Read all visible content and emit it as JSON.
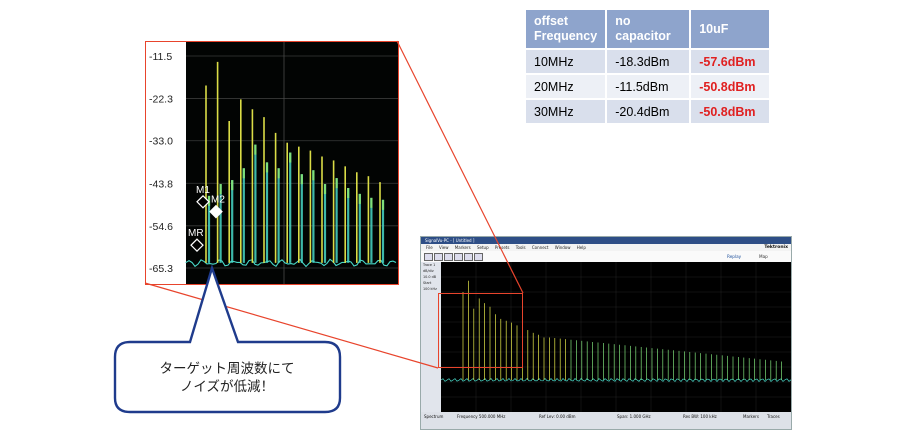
{
  "table": {
    "headers": [
      "offset\nFrequency",
      "no\ncapacitor",
      "10uF"
    ],
    "header_lines": [
      [
        "offset",
        "Frequency"
      ],
      [
        "no",
        "capacitor"
      ],
      [
        "10uF"
      ]
    ],
    "rows": [
      {
        "freq": "10MHz",
        "no_cap": "-18.3dBm",
        "cap_10uF": "-57.6dBm"
      },
      {
        "freq": "20MHz",
        "no_cap": "-11.5dBm",
        "cap_10uF": "-50.8dBm"
      },
      {
        "freq": "30MHz",
        "no_cap": "-20.4dBm",
        "cap_10uF": "-50.8dBm"
      }
    ],
    "highlight_color": "#e02020",
    "header_bg": "#8ea4cc"
  },
  "callout": {
    "line1": "ターゲット周波数にて",
    "line2": "ノイズが低減！",
    "border_color": "#1f3b8c"
  },
  "colors": {
    "zoom_border": "#e8442c",
    "trace_yellow": "#e6e84a",
    "trace_cyan": "#48d8c8",
    "trace_green": "#7fe07a"
  },
  "chart_data": {
    "type": "line",
    "title": "",
    "xlabel": "",
    "ylabel": "",
    "y_ticks": [
      -11.5,
      -22.3,
      -33.0,
      -43.8,
      -54.6,
      -65.3
    ],
    "y_tick_labels": [
      "-11.5",
      "-22.3",
      "-33.0",
      "-43.8",
      "-54.6",
      "-65.3"
    ],
    "ylim": [
      -65.3,
      -11.5
    ],
    "grid": true,
    "series": [
      {
        "color": "#e6e84a",
        "peaks": [
          -19.0,
          -13.0,
          -28.0,
          -22.5,
          -25.0,
          -27.0,
          -31.0,
          -33.5,
          -34.5,
          -35.5,
          -37.0,
          -38.0,
          -39.5,
          -41.0,
          -42.0,
          -43.5
        ]
      },
      {
        "color": "#48d8c8",
        "peaks": [
          -47.0,
          -44.0,
          -43.0,
          -40.0,
          -34.0,
          -38.5,
          -40.0,
          -36.0,
          -41.5,
          -40.5,
          -44.0,
          -42.5,
          -45.0,
          -46.5,
          -47.5,
          -48.0
        ]
      }
    ],
    "noise_floor": -64.0,
    "markers": [
      {
        "label": "M1",
        "y": -48.5
      },
      {
        "label": "M2",
        "y": -51.0
      },
      {
        "label": "MR",
        "y": -59.5
      }
    ]
  },
  "inset_app": {
    "title": "SignalVu-PC - [ Untitled ]",
    "menu": [
      "File",
      "View",
      "Markers",
      "Setup",
      "Presets",
      "Tools",
      "Connect",
      "Window",
      "Help"
    ],
    "brand": "Tektronix",
    "replay": "Replay",
    "map": "Map",
    "side": [
      "Trace 1",
      "dB/div",
      "10.0 dB",
      "Start",
      "100 kHz"
    ],
    "bottom": {
      "mode": "Spectrum",
      "freq": "Frequency 500.000 MHz",
      "ref": "Ref Lev: 0.00 dBm",
      "span": "Span: 1.000 GHz",
      "rbw": "Res BW: 100 kHz",
      "markers": "Markers",
      "traces": "Traces"
    }
  }
}
